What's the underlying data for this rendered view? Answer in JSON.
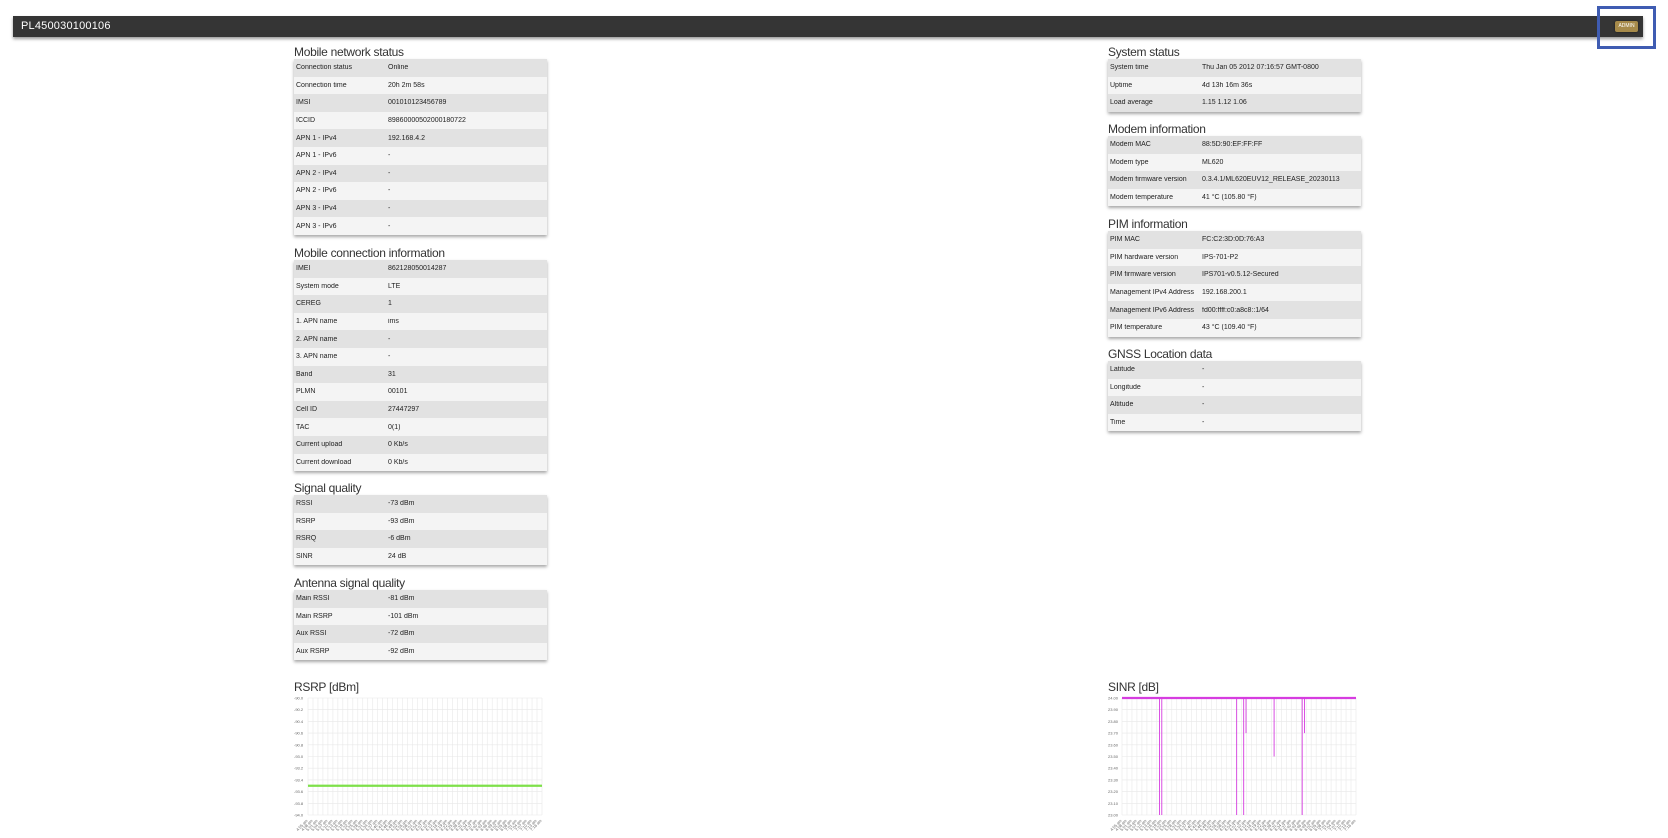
{
  "header": {
    "device_id": "PL450030100106",
    "admin_label": "ADMIN"
  },
  "left_sections": [
    {
      "title": "Mobile network status",
      "rows": [
        [
          "Connection status",
          "Online"
        ],
        [
          "Connection time",
          "20h 2m 58s"
        ],
        [
          "IMSI",
          "001010123456789"
        ],
        [
          "ICCID",
          "89860000502000180722"
        ],
        [
          "APN 1 - IPv4",
          "192.168.4.2"
        ],
        [
          "APN 1 - IPv6",
          "-"
        ],
        [
          "APN 2 - IPv4",
          "-"
        ],
        [
          "APN 2 - IPv6",
          "-"
        ],
        [
          "APN 3 - IPv4",
          "-"
        ],
        [
          "APN 3 - IPv6",
          "-"
        ]
      ]
    },
    {
      "title": "Mobile connection information",
      "rows": [
        [
          "IMEI",
          "862128050014287"
        ],
        [
          "System mode",
          "LTE"
        ],
        [
          "CEREG",
          "1"
        ],
        [
          "1. APN name",
          "ims"
        ],
        [
          "2. APN name",
          "-"
        ],
        [
          "3. APN name",
          "-"
        ],
        [
          "Band",
          "31"
        ],
        [
          "PLMN",
          "00101"
        ],
        [
          "Cell ID",
          "27447297"
        ],
        [
          "TAC",
          "0(1)"
        ],
        [
          "Current upload",
          "0 Kb/s"
        ],
        [
          "Current download",
          "0 Kb/s"
        ]
      ]
    },
    {
      "title": "Signal quality",
      "rows": [
        [
          "RSSI",
          "-73 dBm"
        ],
        [
          "RSRP",
          "-93 dBm"
        ],
        [
          "RSRQ",
          "-6 dBm"
        ],
        [
          "SINR",
          "24 dB"
        ]
      ]
    },
    {
      "title": "Antenna signal quality",
      "rows": [
        [
          "Main RSSI",
          "-81 dBm"
        ],
        [
          "Main RSRP",
          "-101 dBm"
        ],
        [
          "Aux RSSI",
          "-72 dBm"
        ],
        [
          "Aux RSRP",
          "-92 dBm"
        ]
      ]
    }
  ],
  "right_sections": [
    {
      "title": "System status",
      "rows": [
        [
          "System time",
          "Thu Jan 05 2012 07:16:57 GMT-0800"
        ],
        [
          "Uptime",
          "4d 13h 16m 36s"
        ],
        [
          "Load average",
          "1.15 1.12 1.06"
        ]
      ]
    },
    {
      "title": "Modem information",
      "rows": [
        [
          "Modem MAC",
          "88:5D:90:EF:FF:FF"
        ],
        [
          "Modem type",
          "ML620"
        ],
        [
          "Modem firmware version",
          "0.3.4.1/ML620EUV12_RELEASE_20230113"
        ],
        [
          "Modem temperature",
          "41 °C (105.80 °F)"
        ]
      ]
    },
    {
      "title": "PIM information",
      "rows": [
        [
          "PIM MAC",
          "FC:C2:3D:0D:76:A3"
        ],
        [
          "PIM hardware version",
          "IPS-701-P2"
        ],
        [
          "PIM firmware version",
          "IPS701-v0.5.12-Secured"
        ],
        [
          "Management IPv4 Address",
          "192.168.200.1"
        ],
        [
          "Management IPv6 Address",
          "fd00:ffff:c0:a8c8::1/64"
        ],
        [
          "PIM temperature",
          "43 °C (109.40 °F)"
        ]
      ]
    },
    {
      "title": "GNSS Location data",
      "rows": [
        [
          "Latitude",
          "-"
        ],
        [
          "Longitude",
          "-"
        ],
        [
          "Altitude",
          "-"
        ],
        [
          "Time",
          "-"
        ]
      ]
    }
  ],
  "chart_data": [
    {
      "type": "line",
      "title": "RSRP [dBm]",
      "color": "#7ee04a",
      "y_ticks": [
        "-90.0",
        "-90.2",
        "-90.4",
        "-90.6",
        "-90.8",
        "-93.0",
        "-93.2",
        "-93.4",
        "-93.6",
        "-93.8",
        "-94.0"
      ],
      "x_ticks": [
        "4:55 am",
        "4:58 am",
        "5:01 am",
        "5:04 am",
        "5:07 am",
        "5:10 am",
        "5:13 am",
        "5:16 am",
        "5:19 am",
        "5:22 am",
        "5:25 am",
        "5:28 am",
        "5:31 am",
        "5:34 am",
        "5:37 am",
        "5:40 am",
        "5:43 am",
        "5:46 am",
        "5:49 am",
        "5:52 am",
        "5:55 am",
        "5:58 am",
        "6:01 am",
        "6:04 am",
        "6:07 am",
        "6:10 am",
        "6:13 am",
        "6:16 am",
        "6:19 am",
        "6:22 am",
        "6:25 am",
        "6:28 am",
        "6:31 am",
        "6:34 am",
        "6:37 am",
        "6:40 am",
        "6:43 am",
        "6:46 am",
        "6:49 am",
        "6:52 am",
        "6:55 am",
        "6:58 am",
        "7:01 am",
        "7:04 am",
        "7:07 am",
        "7:10 am",
        "7:13 am",
        "7:16 am"
      ],
      "series": [
        {
          "values_constant": -93.0
        }
      ],
      "grid": true
    },
    {
      "type": "line",
      "title": "SINR [dB]",
      "color": "#d63de0",
      "y_ticks": [
        "24.00",
        "23.90",
        "23.80",
        "23.70",
        "23.60",
        "23.50",
        "23.40",
        "23.30",
        "23.20",
        "23.10",
        "23.00"
      ],
      "x_ticks": [
        "4:55 am",
        "4:58 am",
        "5:01 am",
        "5:04 am",
        "5:07 am",
        "5:10 am",
        "5:13 am",
        "5:16 am",
        "5:19 am",
        "5:22 am",
        "5:25 am",
        "5:28 am",
        "5:31 am",
        "5:34 am",
        "5:37 am",
        "5:40 am",
        "5:43 am",
        "5:46 am",
        "5:49 am",
        "5:52 am",
        "5:55 am",
        "5:58 am",
        "6:01 am",
        "6:04 am",
        "6:07 am",
        "6:10 am",
        "6:13 am",
        "6:16 am",
        "6:19 am",
        "6:22 am",
        "6:25 am",
        "6:28 am",
        "6:31 am",
        "6:34 am",
        "6:37 am",
        "6:40 am",
        "6:43 am",
        "6:46 am",
        "6:49 am",
        "6:52 am",
        "6:55 am",
        "6:58 am",
        "7:01 am",
        "7:04 am",
        "7:07 am",
        "7:10 am",
        "7:13 am",
        "7:16 am"
      ],
      "series": [
        {
          "baseline": 24.0,
          "dips": [
            [
              0.16,
              23.0
            ],
            [
              0.17,
              23.0
            ],
            [
              0.49,
              23.0
            ],
            [
              0.52,
              23.0
            ],
            [
              0.53,
              23.7
            ],
            [
              0.65,
              23.5
            ],
            [
              0.77,
              23.0
            ],
            [
              0.78,
              23.7
            ]
          ]
        }
      ],
      "grid": true
    }
  ]
}
